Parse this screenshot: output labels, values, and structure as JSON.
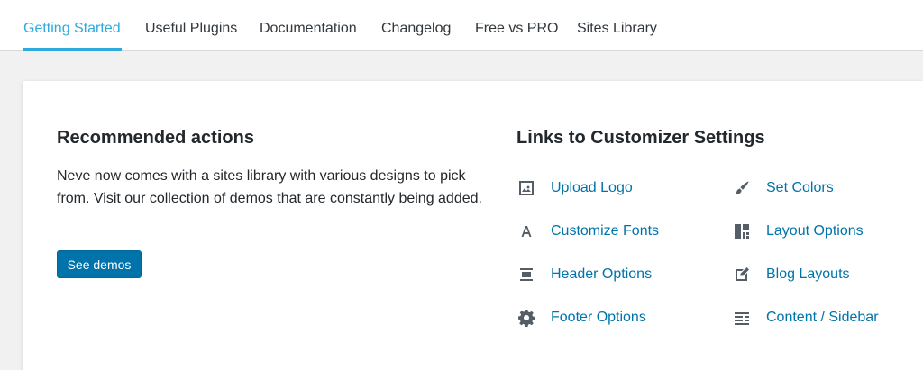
{
  "tabs": [
    {
      "label": "Getting Started",
      "active": true
    },
    {
      "label": "Useful Plugins",
      "active": false
    },
    {
      "label": "Documentation",
      "active": false
    },
    {
      "label": "Changelog",
      "active": false
    },
    {
      "label": "Free vs PRO",
      "active": false
    },
    {
      "label": "Sites Library",
      "active": false
    }
  ],
  "recommended": {
    "title": "Recommended actions",
    "description": "Neve now comes with a sites library with various designs to pick from. Visit our collection of demos that are constantly being added.",
    "button_label": "See demos"
  },
  "customizer": {
    "title": "Links to Customizer Settings",
    "links": [
      {
        "label": "Upload Logo",
        "icon": "image-icon"
      },
      {
        "label": "Set Colors",
        "icon": "brush-icon"
      },
      {
        "label": "Customize Fonts",
        "icon": "font-icon"
      },
      {
        "label": "Layout Options",
        "icon": "layout-icon"
      },
      {
        "label": "Header Options",
        "icon": "header-icon"
      },
      {
        "label": "Blog Layouts",
        "icon": "edit-page-icon"
      },
      {
        "label": "Footer Options",
        "icon": "gear-icon"
      },
      {
        "label": "Content / Sidebar",
        "icon": "align-left-icon"
      }
    ]
  },
  "colors": {
    "accent": "#2eaadc",
    "link": "#0073aa",
    "button": "#0073aa",
    "icon": "#555d66"
  }
}
